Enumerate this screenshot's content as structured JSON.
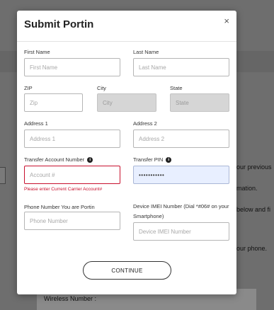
{
  "background": {
    "text_lines": [
      "our previous",
      "mation.",
      "below and fi",
      "our phone."
    ],
    "wireless_label": "Wireless Number :"
  },
  "modal": {
    "title": "Submit Portin",
    "close_glyph": "×",
    "fields": {
      "first_name": {
        "label": "First Name",
        "placeholder": "First Name"
      },
      "last_name": {
        "label": "Last Name",
        "placeholder": "Last Name"
      },
      "zip": {
        "label": "ZIP",
        "placeholder": "Zip"
      },
      "city": {
        "label": "City",
        "placeholder": "City"
      },
      "state": {
        "label": "State",
        "placeholder": "State"
      },
      "address1": {
        "label": "Address 1",
        "placeholder": "Address 1"
      },
      "address2": {
        "label": "Address 2",
        "placeholder": "Address 2"
      },
      "transfer_account": {
        "label": "Transfer Account Number",
        "placeholder": "Account #",
        "error": "Please enter Current Carrier Account#"
      },
      "transfer_pin": {
        "label": "Transfer PIN",
        "value": "•••••••••••"
      },
      "phone": {
        "label": "Phone Number You are Portin",
        "placeholder": "Phone Number"
      },
      "imei": {
        "label": "Device IMEI Number (Dial *#06# on your Smartphone)",
        "placeholder": "Device IMEI Number"
      }
    },
    "info_glyph": "i",
    "continue_label": "CONTINUE"
  },
  "colors": {
    "error": "#c8102e",
    "overlay": "#6e6e6e",
    "disabled_field": "#d6d6d6",
    "autofill_field": "#e8efff"
  }
}
